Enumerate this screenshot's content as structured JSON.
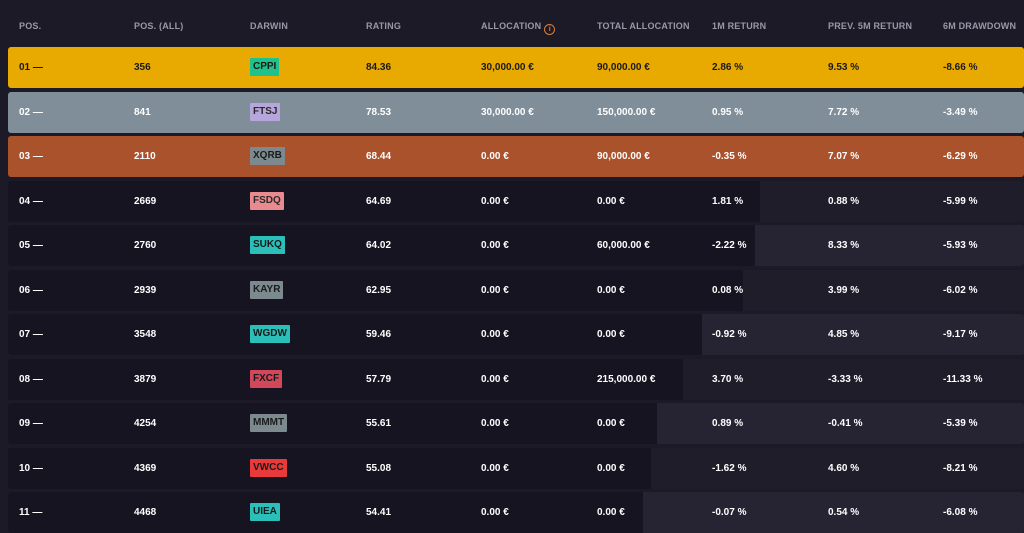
{
  "header": {
    "pos": "POS.",
    "pos_all": "POS. (ALL)",
    "darwin": "DARWIN",
    "rating": "RATING",
    "allocation": "ALLOCATION",
    "total_allocation": "TOTAL ALLOCATION",
    "return_1m": "1M RETURN",
    "prev_return_5m": "PREV. 5M RETURN",
    "drawdown_6m": "6M DRAWDOWN"
  },
  "rows": [
    {
      "pos": "01 —",
      "pos_all": "356",
      "darwin": "CPPI",
      "darwin_color": "#1fc28a",
      "darwin_text_color": "#1a1a1a",
      "rating": "84.36",
      "allocation": "30,000.00 €",
      "total_allocation": "90,000.00 €",
      "return_1m": "2.86 %",
      "prev_return_5m": "9.53 %",
      "drawdown_6m": "-8.66 %",
      "highlight": "#e8a900",
      "text_color": "#1a1a1a"
    },
    {
      "pos": "02 —",
      "pos_all": "841",
      "darwin": "FTSJ",
      "darwin_color": "#b7a6dc",
      "darwin_text_color": "#2a2a2a",
      "rating": "78.53",
      "allocation": "30,000.00 €",
      "total_allocation": "150,000.00 €",
      "return_1m": "0.95 %",
      "prev_return_5m": "7.72 %",
      "drawdown_6m": "-3.49 %",
      "highlight": "#7f8e99",
      "text_color": "#ffffff"
    },
    {
      "pos": "03 —",
      "pos_all": "2110",
      "darwin": "XQRB",
      "darwin_color": "#7c8a8f",
      "darwin_text_color": "#1a1a1a",
      "rating": "68.44",
      "allocation": "0.00 €",
      "total_allocation": "90,000.00 €",
      "return_1m": "-0.35 %",
      "prev_return_5m": "7.07 %",
      "drawdown_6m": "-6.29 %",
      "highlight": "#a9522c",
      "text_color": "#ffffff"
    },
    {
      "pos": "04 —",
      "pos_all": "2669",
      "darwin": "FSDQ",
      "darwin_color": "#e88a8e",
      "darwin_text_color": "#2a2a2a",
      "rating": "64.69",
      "allocation": "0.00 €",
      "total_allocation": "0.00 €",
      "return_1m": "1.81 %",
      "prev_return_5m": "0.88 %",
      "drawdown_6m": "-5.99 %",
      "shade_fraction": 0.74,
      "text_color": "#ffffff"
    },
    {
      "pos": "05 —",
      "pos_all": "2760",
      "darwin": "SUKQ",
      "darwin_color": "#2abfb8",
      "darwin_text_color": "#1a1a1a",
      "rating": "64.02",
      "allocation": "0.00 €",
      "total_allocation": "60,000.00 €",
      "return_1m": "-2.22 %",
      "prev_return_5m": "8.33 %",
      "drawdown_6m": "-5.93 %",
      "shade_fraction": 0.735,
      "text_color": "#ffffff"
    },
    {
      "pos": "06 —",
      "pos_all": "2939",
      "darwin": "KAYR",
      "darwin_color": "#7c8a8f",
      "darwin_text_color": "#1a1a1a",
      "rating": "62.95",
      "allocation": "0.00 €",
      "total_allocation": "0.00 €",
      "return_1m": "0.08 %",
      "prev_return_5m": "3.99 %",
      "drawdown_6m": "-6.02 %",
      "shade_fraction": 0.723,
      "text_color": "#ffffff"
    },
    {
      "pos": "07 —",
      "pos_all": "3548",
      "darwin": "WGDW",
      "darwin_color": "#2abfb8",
      "darwin_text_color": "#1a1a1a",
      "rating": "59.46",
      "allocation": "0.00 €",
      "total_allocation": "0.00 €",
      "return_1m": "-0.92 %",
      "prev_return_5m": "4.85 %",
      "drawdown_6m": "-9.17 %",
      "shade_fraction": 0.683,
      "text_color": "#ffffff"
    },
    {
      "pos": "08 —",
      "pos_all": "3879",
      "darwin": "FXCF",
      "darwin_color": "#d2475a",
      "darwin_text_color": "#1a1a1a",
      "rating": "57.79",
      "allocation": "0.00 €",
      "total_allocation": "215,000.00 €",
      "return_1m": "3.70 %",
      "prev_return_5m": "-3.33 %",
      "drawdown_6m": "-11.33 %",
      "shade_fraction": 0.664,
      "text_color": "#ffffff"
    },
    {
      "pos": "09 —",
      "pos_all": "4254",
      "darwin": "MMMT",
      "darwin_color": "#7c8a8f",
      "darwin_text_color": "#1a1a1a",
      "rating": "55.61",
      "allocation": "0.00 €",
      "total_allocation": "0.00 €",
      "return_1m": "0.89 %",
      "prev_return_5m": "-0.41 %",
      "drawdown_6m": "-5.39 %",
      "shade_fraction": 0.639,
      "text_color": "#ffffff"
    },
    {
      "pos": "10 —",
      "pos_all": "4369",
      "darwin": "VWCC",
      "darwin_color": "#e83a3a",
      "darwin_text_color": "#1a1a1a",
      "rating": "55.08",
      "allocation": "0.00 €",
      "total_allocation": "0.00 €",
      "return_1m": "-1.62 %",
      "prev_return_5m": "4.60 %",
      "drawdown_6m": "-8.21 %",
      "shade_fraction": 0.633,
      "text_color": "#ffffff"
    },
    {
      "pos": "11 —",
      "pos_all": "4468",
      "darwin": "UIEA",
      "darwin_color": "#2abfb8",
      "darwin_text_color": "#1a1a1a",
      "rating": "54.41",
      "allocation": "0.00 €",
      "total_allocation": "0.00 €",
      "return_1m": "-0.07 %",
      "prev_return_5m": "0.54 %",
      "drawdown_6m": "-6.08 %",
      "shade_fraction": 0.625,
      "text_color": "#ffffff"
    }
  ]
}
